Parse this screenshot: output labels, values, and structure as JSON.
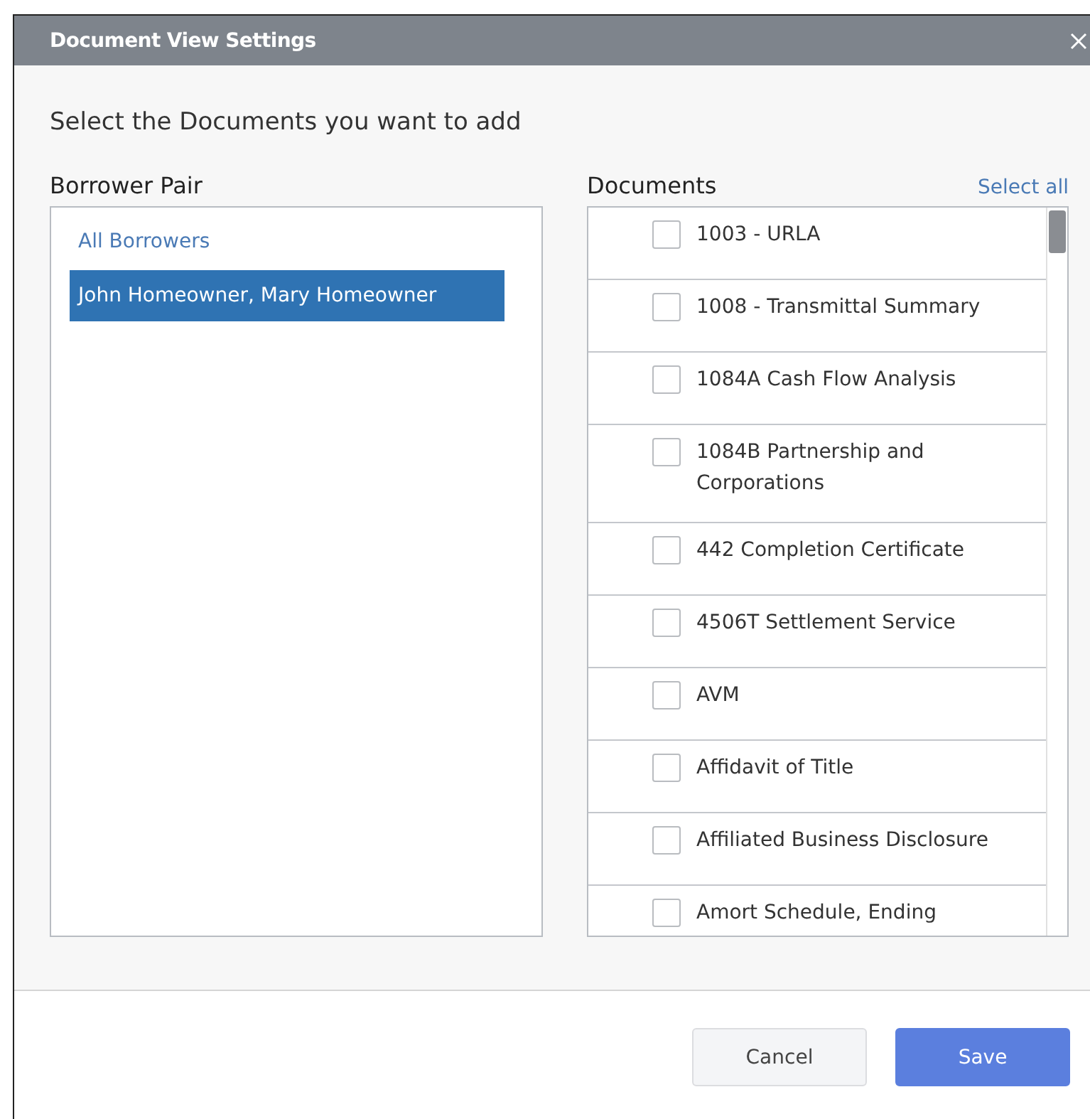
{
  "window": {
    "title": "Document View Settings"
  },
  "instruction": "Select the Documents you want to add",
  "borrower_pair": {
    "heading": "Borrower Pair",
    "items": [
      {
        "label": "All Borrowers",
        "selected": false
      },
      {
        "label": "John Homeowner, Mary Homeowner",
        "selected": true
      }
    ]
  },
  "documents": {
    "heading": "Documents",
    "select_all": "Select all",
    "items": [
      {
        "label": "1003 - URLA",
        "checked": false
      },
      {
        "label": "1008 - Transmittal Summary",
        "checked": false
      },
      {
        "label": "1084A Cash Flow Analysis",
        "checked": false
      },
      {
        "label": "1084B Partnership and Corporations",
        "checked": false
      },
      {
        "label": "442 Completion Certificate",
        "checked": false
      },
      {
        "label": "4506T Settlement Service",
        "checked": false
      },
      {
        "label": "AVM",
        "checked": false
      },
      {
        "label": "Affidavit of Title",
        "checked": false
      },
      {
        "label": "Affiliated Business Disclosure",
        "checked": false
      },
      {
        "label": "Amort Schedule, Ending",
        "checked": false
      }
    ]
  },
  "buttons": [
    {
      "label": "Cancel",
      "kind": "secondary"
    },
    {
      "label": "Save",
      "kind": "primary"
    }
  ]
}
